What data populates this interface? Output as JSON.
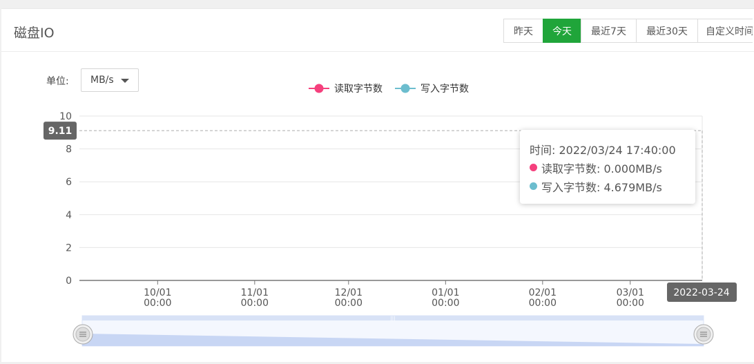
{
  "header": {
    "title": "磁盘IO"
  },
  "range_buttons": [
    {
      "label": "昨天",
      "active": false
    },
    {
      "label": "今天",
      "active": true
    },
    {
      "label": "最近7天",
      "active": false
    },
    {
      "label": "最近30天",
      "active": false
    },
    {
      "label": "自定义时间",
      "active": false
    }
  ],
  "unit": {
    "label": "单位:",
    "value": "MB/s"
  },
  "colors": {
    "accent": "#20a53a",
    "read": "#f5407d",
    "write": "#6cbdce"
  },
  "chart_data": {
    "type": "line",
    "legend": [
      {
        "name": "读取字节数",
        "color": "#f5407d"
      },
      {
        "name": "写入字节数",
        "color": "#6cbdce"
      }
    ],
    "legend_position": "top-center",
    "ylim": [
      0,
      10
    ],
    "y_ticks": [
      "0",
      "2",
      "4",
      "6",
      "8",
      "10"
    ],
    "x_ticks": [
      {
        "line1": "10/01",
        "line2": "00:00"
      },
      {
        "line1": "11/01",
        "line2": "00:00"
      },
      {
        "line1": "12/01",
        "line2": "00:00"
      },
      {
        "line1": "01/01",
        "line2": "00:00"
      },
      {
        "line1": "02/01",
        "line2": "00:00"
      },
      {
        "line1": "03/01",
        "line2": "00:00"
      }
    ],
    "x_range": [
      "2021-09-06",
      "2022-03-24"
    ],
    "x_tick_dates": [
      "2021-10-01",
      "2021-11-01",
      "2021-12-01",
      "2022-01-01",
      "2022-02-01",
      "2022-03-01"
    ],
    "grid": true,
    "crosshair": {
      "y_value": 9.11,
      "y_label": "9.11",
      "x_date": "2022-03-24",
      "x_label": "2022-03-24"
    },
    "tooltip": {
      "time": "时间: 2022/03/24 17:40:00",
      "read": "读取字节数: 0.000MB/s",
      "write": "写入字节数: 4.679MB/s"
    },
    "series": [
      {
        "name": "读取字节数",
        "values": []
      },
      {
        "name": "写入字节数",
        "values": []
      }
    ]
  }
}
